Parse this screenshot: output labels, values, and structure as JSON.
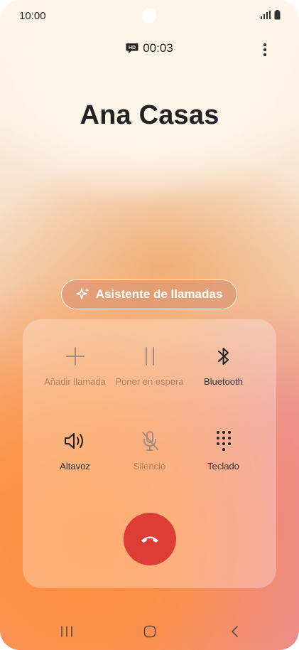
{
  "status_bar": {
    "time": "10:00"
  },
  "call": {
    "hd_badge": "HD",
    "duration": "00:03",
    "contact_name": "Ana Casas"
  },
  "assistant": {
    "label": "Asistente de llamadas"
  },
  "controls": [
    {
      "label": "Añadir llamada",
      "icon": "plus-icon",
      "enabled": false
    },
    {
      "label": "Poner en espera",
      "icon": "pause-icon",
      "enabled": false
    },
    {
      "label": "Bluetooth",
      "icon": "bluetooth-icon",
      "enabled": true
    },
    {
      "label": "Altavoz",
      "icon": "speaker-icon",
      "enabled": true
    },
    {
      "label": "Silencio",
      "icon": "mic-off-icon",
      "enabled": false
    },
    {
      "label": "Teclado",
      "icon": "keypad-icon",
      "enabled": true
    }
  ],
  "colors": {
    "end_call": "#dd3d35",
    "text": "#1f1f1f",
    "disabled": "#a58d80"
  }
}
